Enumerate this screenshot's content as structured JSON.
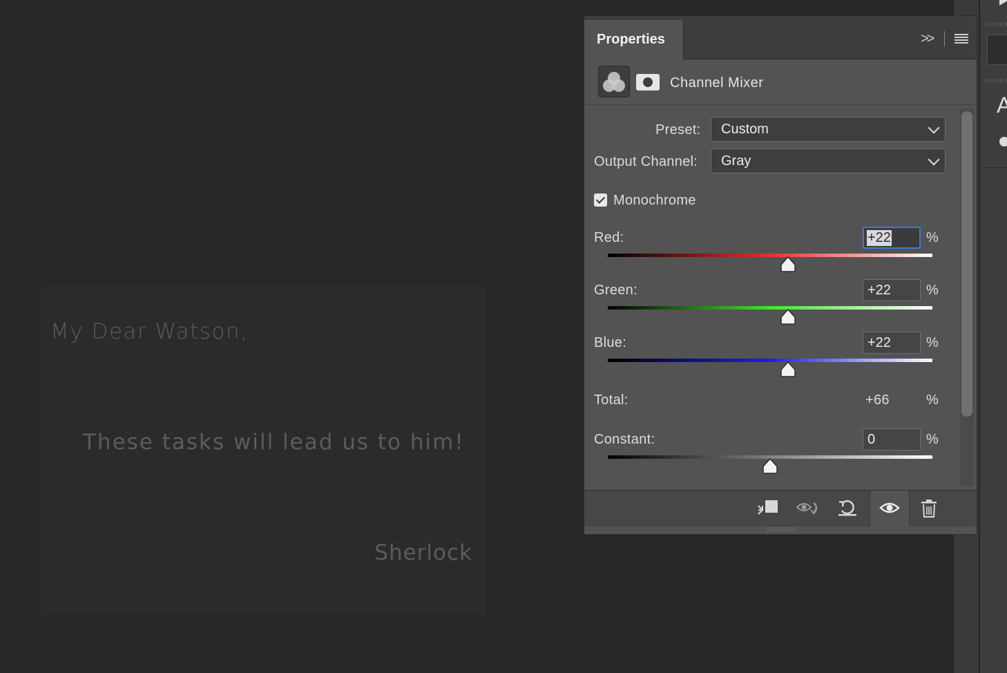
{
  "canvas": {
    "greeting": "My Dear Watson,",
    "body": "These tasks will lead us to him!",
    "signature": "Sherlock"
  },
  "panel": {
    "title": "Properties",
    "adjustment_type": "Channel Mixer",
    "preset_label": "Preset:",
    "preset_value": "Custom",
    "output_label": "Output Channel:",
    "output_value": "Gray",
    "monochrome_label": "Monochrome",
    "monochrome_checked": true,
    "red_label": "Red:",
    "red_value": "+22",
    "red_percent": 22,
    "green_label": "Green:",
    "green_value": "+22",
    "green_percent": 22,
    "blue_label": "Blue:",
    "blue_value": "+22",
    "blue_percent": 22,
    "total_label": "Total:",
    "total_value": "+66",
    "constant_label": "Constant:",
    "constant_value": "0",
    "constant_percent": 0,
    "percent_sign": "%"
  },
  "dock": {
    "letter": "A"
  },
  "colors": {
    "red_gradient": [
      "#000000",
      "#e8302a",
      "#ffffff"
    ],
    "green_gradient": [
      "#000000",
      "#43e32f",
      "#ffffff"
    ],
    "blue_gradient": [
      "#000000",
      "#1f1fe6",
      "#ffffff"
    ],
    "constant_gradient": [
      "#000000",
      "#ffffff"
    ],
    "accent": "#3d78d8"
  },
  "icons": {
    "collapse": "double-chevron-right-icon",
    "menu": "hamburger-menu-icon",
    "adjustment": "channel-mixer-icon",
    "mask": "mask-icon",
    "clip": "clip-to-layer-icon",
    "view_previous": "view-previous-state-icon",
    "reset": "reset-icon",
    "visibility": "eye-icon",
    "delete": "trash-icon"
  }
}
